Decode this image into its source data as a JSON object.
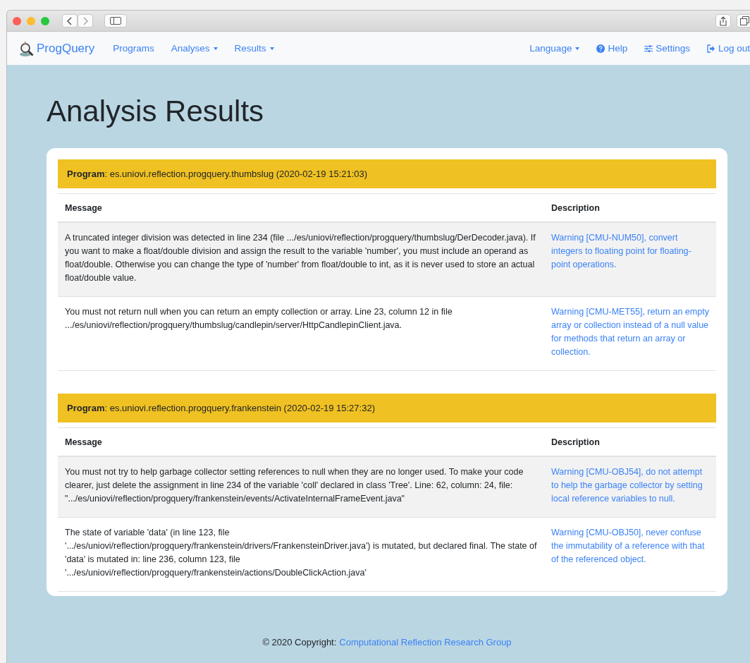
{
  "nav": {
    "brand": "ProgQuery",
    "left": [
      {
        "label": "Programs",
        "dropdown": false
      },
      {
        "label": "Analyses",
        "dropdown": true
      },
      {
        "label": "Results",
        "dropdown": true
      }
    ],
    "right": [
      {
        "label": "Language",
        "kind": "plain",
        "dropdown": true
      },
      {
        "label": "Help",
        "kind": "help",
        "dropdown": false
      },
      {
        "label": "Settings",
        "kind": "settings",
        "dropdown": false
      },
      {
        "label": "Log out",
        "kind": "logout",
        "dropdown": false
      }
    ]
  },
  "heading": "Analysis Results",
  "programs": [
    {
      "header": "**Program**: es.uniovi.reflection.progquery.thumbslug (2020-02-19 15:21:03)",
      "columns": [
        "Message",
        "Description"
      ],
      "rows": [
        {
          "message": "A truncated integer division was detected in line 234 (file .../es/uniovi/reflection/progquery/thumbslug/DerDecoder.java). If you want to make a float/double division and assign the result to the variable 'number', you must include an operand as float/double. Otherwise you can change the type of 'number' from float/double to int, as it is never used to store an actual float/double value.",
          "description": "Warning [CMU-NUM50], convert integers to floating point for floating-point operations."
        },
        {
          "message": "You must not return null when you can return an empty collection or array. Line 23, column 12 in file .../es/uniovi/reflection/progquery/thumbslug/candlepin/server/HttpCandlepinClient.java.",
          "description": "Warning [CMU-MET55], return an empty array or collection instead of a null value for methods that return an array or collection."
        }
      ]
    },
    {
      "header": "**Program**: es.uniovi.reflection.progquery.frankenstein (2020-02-19 15:27:32)",
      "columns": [
        "Message",
        "Description"
      ],
      "rows": [
        {
          "message": "You must not try to help garbage collector setting references to null when they are no longer used. To make your code clearer, just delete the assignment in line 234 of the variable 'coll' declared in class 'Tree'. Line: 62, column: 24, file: \".../es/uniovi/reflection/progquery/frankenstein/events/ActivateInternalFrameEvent.java\"",
          "description": "Warning [CMU-OBJ54], do not attempt to help the garbage collector by setting local reference variables to null."
        },
        {
          "message": "The state of variable 'data' (in line 123, file '.../es/uniovi/reflection/progquery/frankenstein/drivers/FrankensteinDriver.java') is mutated, but declared final. The state of 'data' is mutated in: line 236, column 123, file '.../es/uniovi/reflection/progquery/frankenstein/actions/DoubleClickAction.java'",
          "description": "Warning [CMU-OBJ50], never confuse the immutability of a reference with that of the referenced object."
        }
      ]
    }
  ],
  "footer": {
    "text": "© 2020 Copyright:",
    "link": "Computational Reflection Research Group"
  }
}
